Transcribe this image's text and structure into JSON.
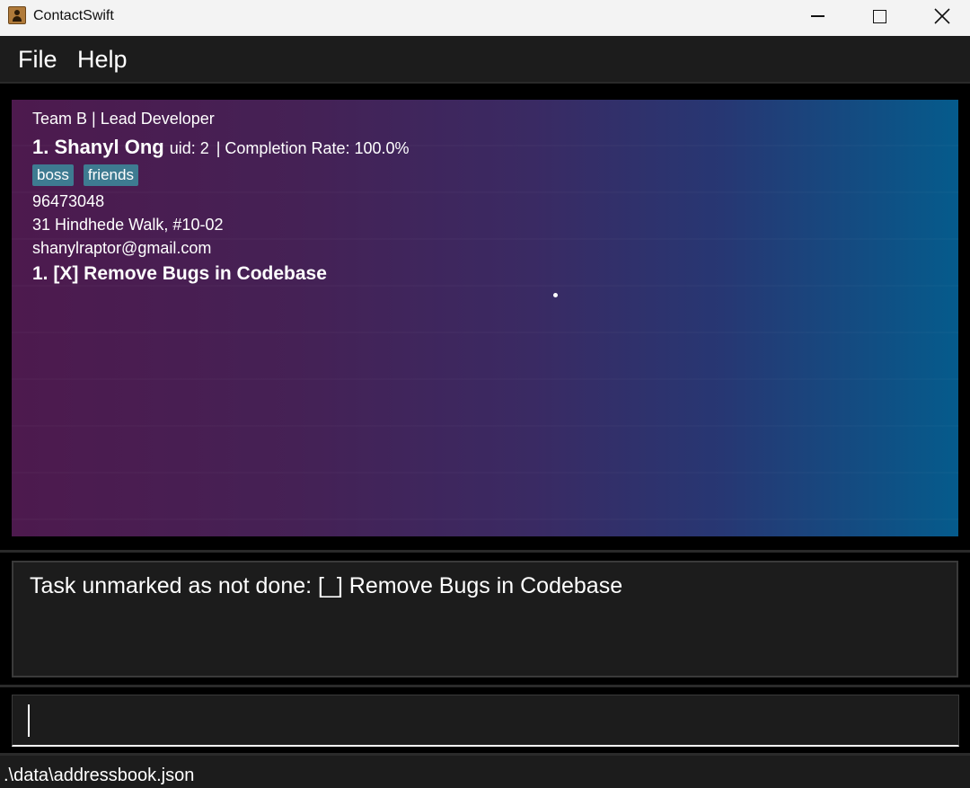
{
  "window": {
    "title": "ContactSwift"
  },
  "menu": {
    "file": "File",
    "help": "Help"
  },
  "person": {
    "team_role": "Team B | Lead Developer",
    "index_name": "1.  Shanyl Ong",
    "uid": "uid: 2",
    "completion": "| Completion Rate: 100.0%",
    "tags": [
      "boss",
      "friends"
    ],
    "phone": "96473048",
    "address": "31 Hindhede Walk, #10-02",
    "email": "shanylraptor@gmail.com",
    "task": "1. [X] Remove Bugs in Codebase"
  },
  "result": {
    "message": "Task unmarked as not done: [_] Remove Bugs in Codebase"
  },
  "command": {
    "value": ""
  },
  "status": {
    "path": ".\\data\\addressbook.json"
  }
}
